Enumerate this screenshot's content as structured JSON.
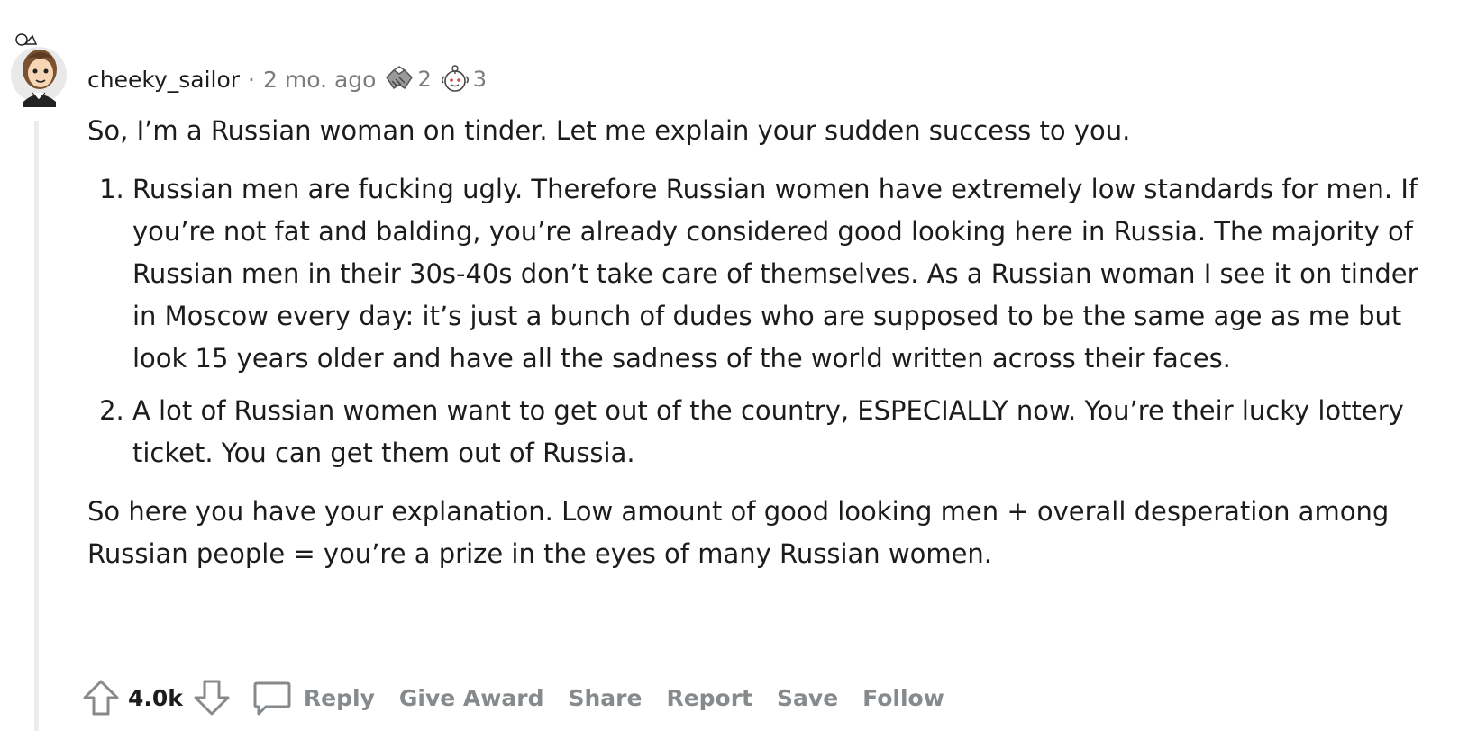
{
  "comment": {
    "author": "cheeky_sailor",
    "separator": "·",
    "time_ago": "2 mo. ago",
    "awards": [
      {
        "icon": "handshake-award-icon",
        "count": "2"
      },
      {
        "icon": "wholesome-award-icon",
        "count": "3"
      }
    ],
    "intro": "So, I’m a Russian woman on tinder. Let me explain your sudden success to you.",
    "points": [
      "Russian men are fucking ugly. Therefore Russian women have extremely low standards for men. If you’re not fat and balding, you’re already considered good looking here in Russia. The majority of Russian men in their 30s-40s don’t take care of themselves. As a Russian woman I see it on tinder in Moscow every day: it’s just a bunch of dudes who are supposed to be the same age as me but look 15 years older and have all the sadness of the world written across their faces.",
      "A lot of Russian women want to get out of the country, ESPECIALLY now. You’re their lucky lottery ticket. You can get them out of Russia."
    ],
    "closing": "So here you have your explanation. Low amount of good looking men + overall desperation among Russian people = you’re a prize in the eyes of many Russian women."
  },
  "actions": {
    "score": "4.0k",
    "reply": "Reply",
    "give_award": "Give Award",
    "share": "Share",
    "report": "Report",
    "save": "Save",
    "follow": "Follow"
  },
  "colors": {
    "text": "#1c1c1c",
    "meta": "#7c7c7c",
    "action": "#878a8c",
    "thread_line": "#ececec"
  }
}
